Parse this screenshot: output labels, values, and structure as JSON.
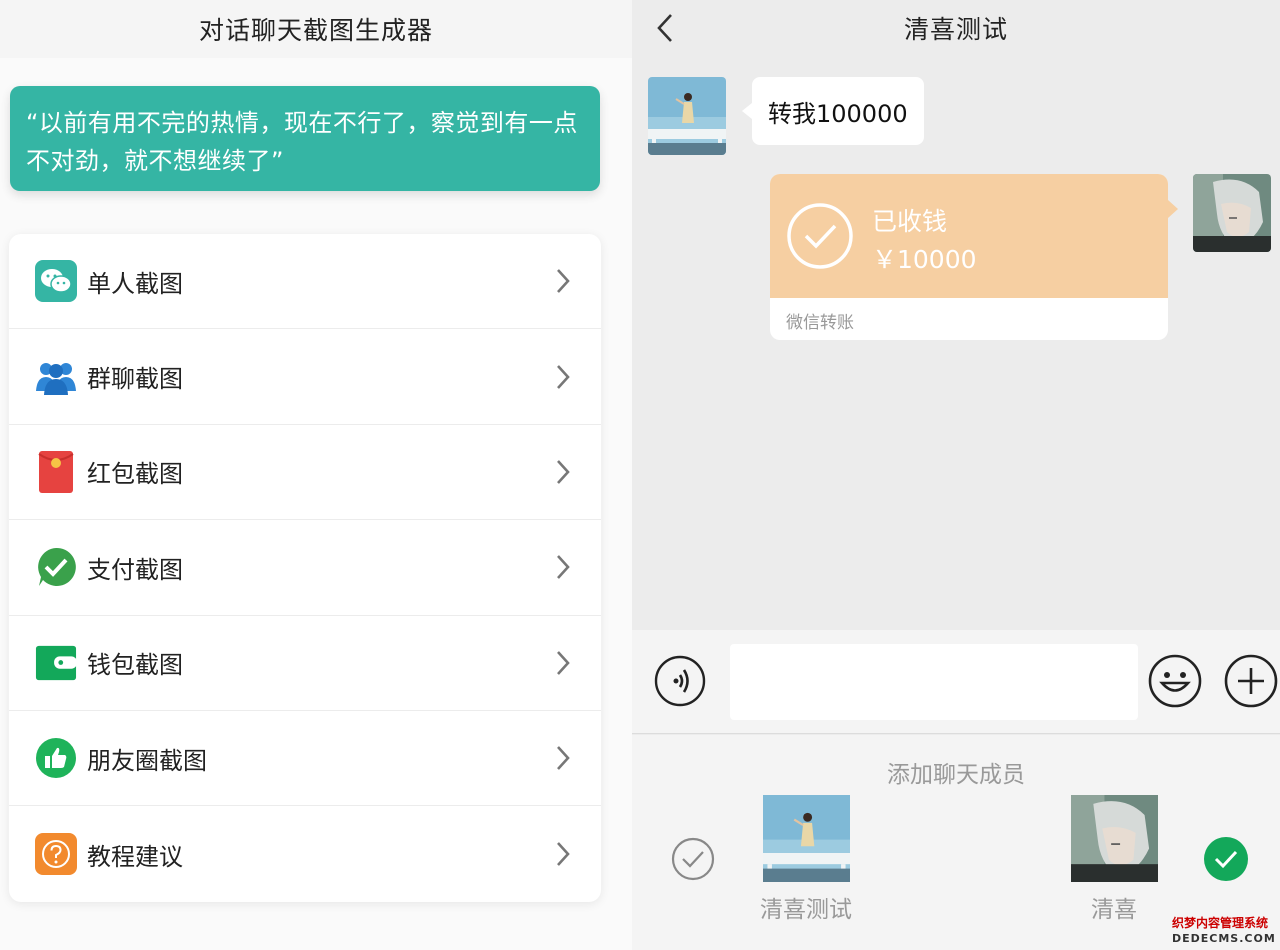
{
  "left_panel": {
    "title": "对话聊天截图生成器",
    "quote": "“以前有用不完的热情，现在不行了，察觉到有一点不对劲，就不想继续了”",
    "menu_items": [
      {
        "label": "单人截图",
        "icon": "wechat-chat-icon",
        "icon_color": "#35b5a4"
      },
      {
        "label": "群聊截图",
        "icon": "group-users-icon",
        "icon_color": "#2f86d6"
      },
      {
        "label": "红包截图",
        "icon": "red-packet-icon",
        "icon_color": "#e64340"
      },
      {
        "label": "支付截图",
        "icon": "payment-check-icon",
        "icon_color": "#3aa14b"
      },
      {
        "label": "钱包截图",
        "icon": "wallet-icon",
        "icon_color": "#13a85a"
      },
      {
        "label": "朋友圈截图",
        "icon": "thumbs-up-icon",
        "icon_color": "#1fb35a"
      },
      {
        "label": "教程建议",
        "icon": "question-icon",
        "icon_color": "#f28a2e"
      }
    ]
  },
  "chat": {
    "title": "清喜测试",
    "incoming_message": "转我100000",
    "transfer": {
      "status": "已收钱",
      "amount": "￥10000",
      "footer": "微信转账",
      "color": "#f6cfa2"
    },
    "input_value": ""
  },
  "members": {
    "title": "添加聊天成员",
    "list": [
      {
        "name": "清喜测试",
        "selected": false
      },
      {
        "name": "清喜",
        "selected": true
      }
    ]
  },
  "watermark": {
    "line1": "织梦内容管理系统",
    "line2": "DEDECMS.COM"
  }
}
